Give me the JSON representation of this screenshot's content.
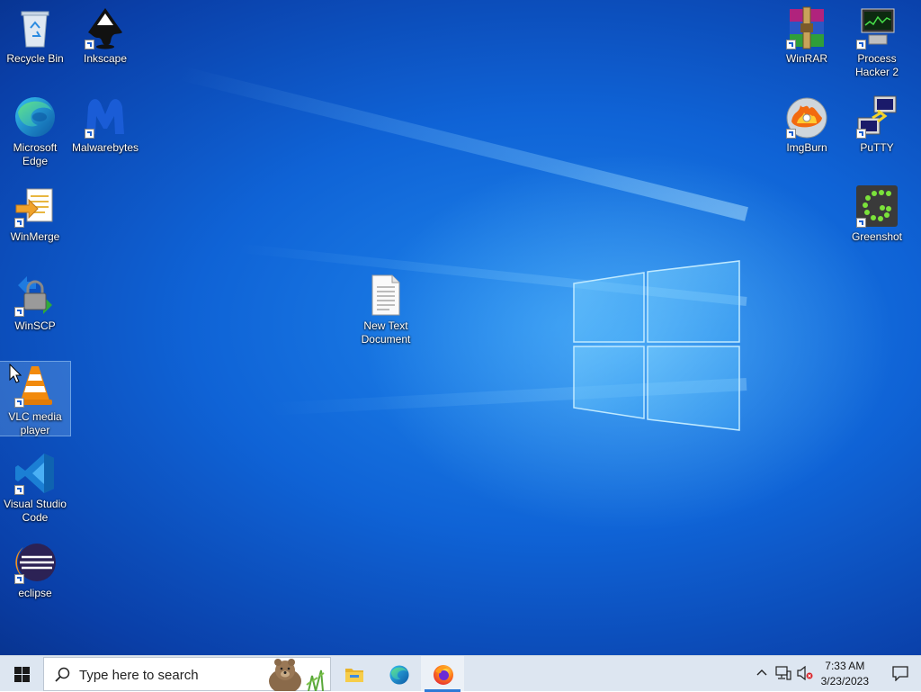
{
  "desktop_icons": [
    {
      "id": "recycle-bin",
      "label": "Recycle Bin"
    },
    {
      "id": "inkscape",
      "label": "Inkscape"
    },
    {
      "id": "microsoft-edge",
      "label": "Microsoft Edge"
    },
    {
      "id": "malwarebytes",
      "label": "Malwarebytes"
    },
    {
      "id": "winmerge",
      "label": "WinMerge"
    },
    {
      "id": "winscp",
      "label": "WinSCP"
    },
    {
      "id": "vlc",
      "label": "VLC media player"
    },
    {
      "id": "vscode",
      "label": "Visual Studio Code"
    },
    {
      "id": "eclipse",
      "label": "eclipse"
    },
    {
      "id": "new-text-document",
      "label": "New Text Document"
    },
    {
      "id": "winrar",
      "label": "WinRAR"
    },
    {
      "id": "process-hacker",
      "label": "Process Hacker 2"
    },
    {
      "id": "imgburn",
      "label": "ImgBurn"
    },
    {
      "id": "putty",
      "label": "PuTTY"
    },
    {
      "id": "greenshot",
      "label": "Greenshot"
    }
  ],
  "taskbar": {
    "search_placeholder": "Type here to search",
    "pinned": [
      "file-explorer-icon",
      "edge-icon",
      "firefox-icon"
    ],
    "active_app": "firefox"
  },
  "clock": {
    "time": "7:33 AM",
    "date": "3/23/2023"
  },
  "colors": {
    "desktop": "#0f63d6",
    "taskbar": "#dde6f1",
    "accent": "#2d7ad6"
  }
}
